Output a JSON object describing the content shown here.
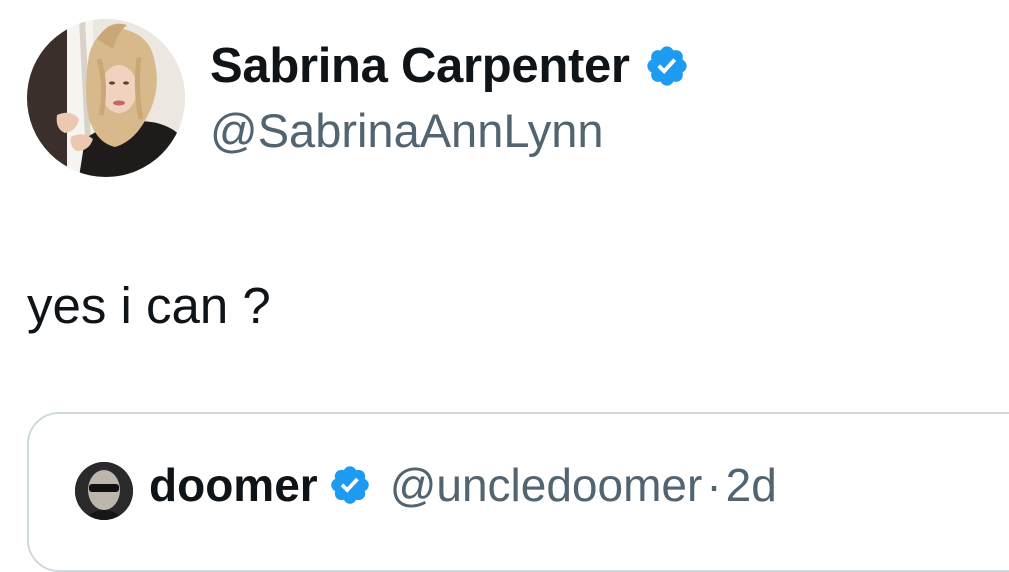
{
  "tweet": {
    "author": {
      "display_name": "Sabrina Carpenter",
      "handle": "@SabrinaAnnLynn",
      "verified": true,
      "avatar_icon": "profile-photo"
    },
    "text": "yes i can ?",
    "quoted_tweet": {
      "author": {
        "display_name": "doomer",
        "handle": "@uncledoomer",
        "verified": true,
        "avatar_icon": "profile-photo"
      },
      "separator": "·",
      "time": "2d"
    }
  },
  "colors": {
    "text_primary": "#0f1419",
    "text_secondary": "#536471",
    "verified_badge": "#1d9bf0",
    "card_border": "#cfd9de"
  }
}
